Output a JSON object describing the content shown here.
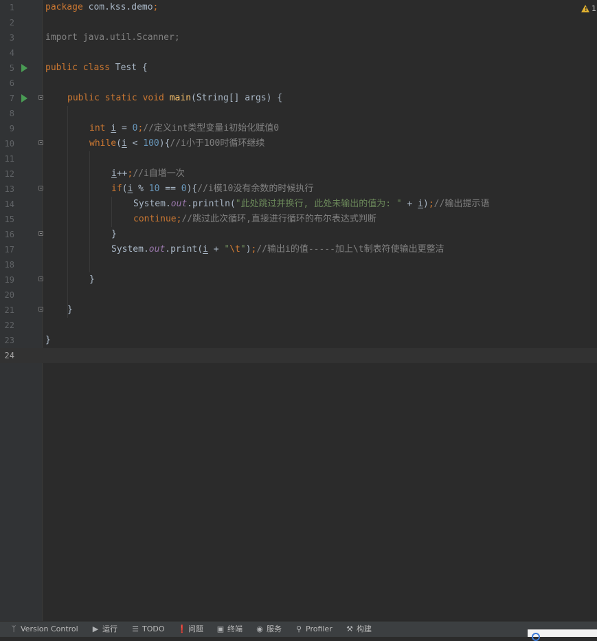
{
  "editor": {
    "warning": {
      "icon": "warning-triangle-icon",
      "count": "1"
    },
    "current_line": 24,
    "lines": [
      {
        "n": "1",
        "code": [
          {
            "k": "kw",
            "t": "package "
          },
          {
            "k": "",
            "t": "com.kss.demo"
          },
          {
            "k": "kw",
            "t": ";"
          }
        ]
      },
      {
        "n": "2",
        "code": []
      },
      {
        "n": "3",
        "code": [
          {
            "k": "imp",
            "t": "import java.util.Scanner;"
          }
        ]
      },
      {
        "n": "4",
        "code": []
      },
      {
        "n": "5",
        "code": [
          {
            "k": "kw",
            "t": "public class "
          },
          {
            "k": "",
            "t": "Test {"
          }
        ]
      },
      {
        "n": "6",
        "code": []
      },
      {
        "n": "7",
        "code": [
          {
            "k": "kw",
            "t": "public static void "
          },
          {
            "k": "fn",
            "t": "main"
          },
          {
            "k": "",
            "t": "(String[] args) {"
          }
        ]
      },
      {
        "n": "8",
        "code": []
      },
      {
        "n": "9",
        "code": [
          {
            "k": "kw",
            "t": "int "
          },
          {
            "k": "ul",
            "t": "i"
          },
          {
            "k": "",
            "t": " = "
          },
          {
            "k": "num",
            "t": "0"
          },
          {
            "k": "kw",
            "t": ";"
          },
          {
            "k": "cm",
            "t": "//定义int类型变量i初始化赋值0"
          }
        ]
      },
      {
        "n": "10",
        "code": [
          {
            "k": "kw",
            "t": "while"
          },
          {
            "k": "",
            "t": "("
          },
          {
            "k": "ul",
            "t": "i"
          },
          {
            "k": "",
            "t": " < "
          },
          {
            "k": "num",
            "t": "100"
          },
          {
            "k": "",
            "t": "){"
          },
          {
            "k": "cm",
            "t": "//i小于100时循环继续"
          }
        ]
      },
      {
        "n": "11",
        "code": []
      },
      {
        "n": "12",
        "code": [
          {
            "k": "ul",
            "t": "i"
          },
          {
            "k": "",
            "t": "++"
          },
          {
            "k": "kw",
            "t": ";"
          },
          {
            "k": "cm",
            "t": "//i自增一次"
          }
        ]
      },
      {
        "n": "13",
        "code": [
          {
            "k": "kw",
            "t": "if"
          },
          {
            "k": "",
            "t": "("
          },
          {
            "k": "ul",
            "t": "i"
          },
          {
            "k": "",
            "t": " % "
          },
          {
            "k": "num",
            "t": "10"
          },
          {
            "k": "",
            "t": " == "
          },
          {
            "k": "num",
            "t": "0"
          },
          {
            "k": "",
            "t": "){"
          },
          {
            "k": "cm",
            "t": "//i模10没有余数的时候执行"
          }
        ]
      },
      {
        "n": "14",
        "code": [
          {
            "k": "",
            "t": "System."
          },
          {
            "k": "st",
            "t": "out"
          },
          {
            "k": "",
            "t": ".println("
          },
          {
            "k": "str",
            "t": "\"此处跳过并换行, 此处未输出的值为: \""
          },
          {
            "k": "",
            "t": " + "
          },
          {
            "k": "ul",
            "t": "i"
          },
          {
            "k": "",
            "t": ")"
          },
          {
            "k": "kw",
            "t": ";"
          },
          {
            "k": "cm",
            "t": "//输出提示语"
          }
        ]
      },
      {
        "n": "15",
        "code": [
          {
            "k": "kw",
            "t": "continue;"
          },
          {
            "k": "cm",
            "t": "//跳过此次循环,直接进行循环的布尔表达式判断"
          }
        ]
      },
      {
        "n": "16",
        "code": [
          {
            "k": "",
            "t": "}"
          }
        ]
      },
      {
        "n": "17",
        "code": [
          {
            "k": "",
            "t": "System."
          },
          {
            "k": "st",
            "t": "out"
          },
          {
            "k": "",
            "t": ".print("
          },
          {
            "k": "ul",
            "t": "i"
          },
          {
            "k": "",
            "t": " + "
          },
          {
            "k": "str",
            "t": "\""
          },
          {
            "k": "kw",
            "t": "\\t"
          },
          {
            "k": "str",
            "t": "\""
          },
          {
            "k": "",
            "t": ")"
          },
          {
            "k": "kw",
            "t": ";"
          },
          {
            "k": "cm",
            "t": "//输出i的值-----加上\\t制表符使输出更整洁"
          }
        ]
      },
      {
        "n": "18",
        "code": []
      },
      {
        "n": "19",
        "code": [
          {
            "k": "",
            "t": "}"
          }
        ]
      },
      {
        "n": "20",
        "code": []
      },
      {
        "n": "21",
        "code": [
          {
            "k": "",
            "t": "}"
          }
        ]
      },
      {
        "n": "22",
        "code": []
      },
      {
        "n": "23",
        "code": [
          {
            "k": "",
            "t": "}"
          }
        ]
      },
      {
        "n": "24",
        "code": []
      }
    ]
  },
  "statusbar": {
    "items": [
      {
        "label": "Version Control",
        "icon": "branch-icon"
      },
      {
        "label": "运行",
        "icon": "run-icon"
      },
      {
        "label": "TODO",
        "icon": "list-icon"
      },
      {
        "label": "问题",
        "icon": "problems-icon"
      },
      {
        "label": "终端",
        "icon": "terminal-icon"
      },
      {
        "label": "服务",
        "icon": "services-icon"
      },
      {
        "label": "Profiler",
        "icon": "profiler-icon"
      },
      {
        "label": "构建",
        "icon": "hammer-icon"
      }
    ]
  },
  "colors": {
    "background": "#2b2b2b",
    "gutter": "#313335",
    "keyword": "#cc7832",
    "function": "#ffc66d",
    "number": "#6897bb",
    "string": "#6a8759",
    "comment": "#808080",
    "static_field": "#9876aa",
    "run_marker": "#499c54",
    "warning": "#e0b030"
  }
}
